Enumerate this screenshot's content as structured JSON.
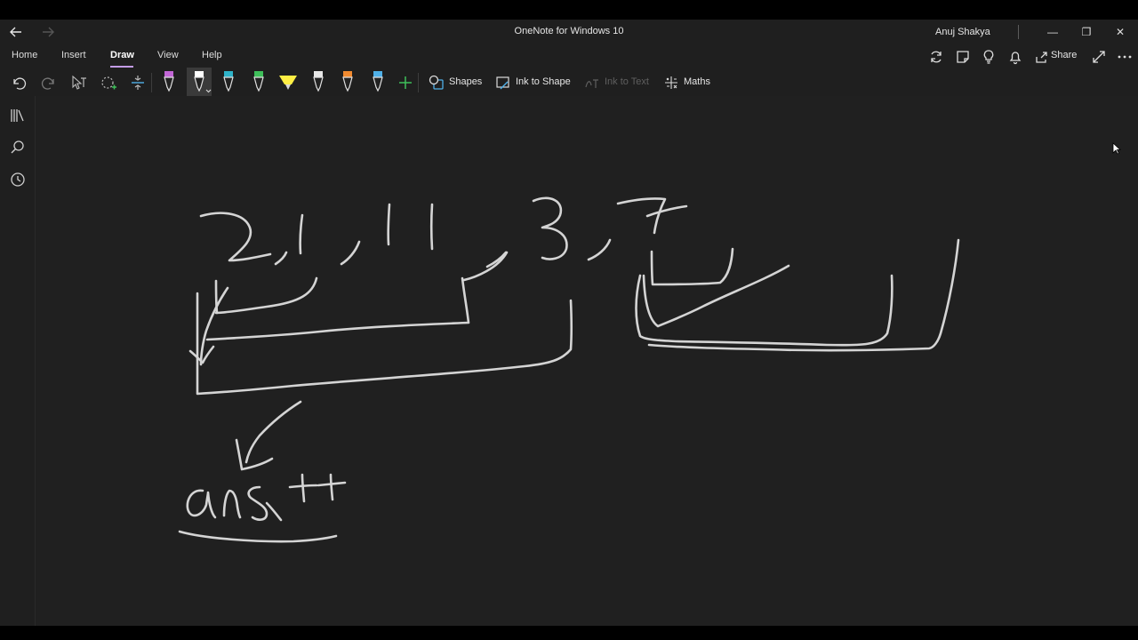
{
  "window": {
    "title": "OneNote for Windows 10",
    "user": "Anuj Shakya",
    "back_icon": "arrow-left-icon",
    "forward_icon": "arrow-right-icon",
    "minimize_glyph": "—",
    "maximize_glyph": "❐",
    "close_glyph": "✕"
  },
  "tabs": [
    {
      "label": "Home"
    },
    {
      "label": "Insert"
    },
    {
      "label": "Draw",
      "active": true
    },
    {
      "label": "View"
    },
    {
      "label": "Help"
    }
  ],
  "header_tools": {
    "icons": [
      "sync-icon",
      "sticky-note-icon",
      "lightbulb-icon",
      "bell-icon"
    ],
    "share_label": "Share"
  },
  "draw_toolbar": {
    "undo_icon": "undo-icon",
    "redo_icon": "redo-icon",
    "shapes_label": "Shapes",
    "ink_to_shape_label": "Ink to Shape",
    "ink_to_text_label": "Ink to Text",
    "maths_label": "Maths",
    "pens": [
      {
        "kind": "pen",
        "color": "#c266d6"
      },
      {
        "kind": "pen",
        "color": "#ffffff",
        "selected": true
      },
      {
        "kind": "pen",
        "color": "#2fb3c9"
      },
      {
        "kind": "pen",
        "color": "#3fbf5a"
      },
      {
        "kind": "highlighter",
        "color": "#ffee44"
      },
      {
        "kind": "pen",
        "color": "#e8e8e8"
      },
      {
        "kind": "pen",
        "color": "#f08a30"
      },
      {
        "kind": "pen",
        "color": "#4fb0e8"
      }
    ]
  },
  "sidebar": {
    "icons": [
      "notebooks-icon",
      "search-icon",
      "recent-icon"
    ]
  },
  "colors": {
    "background": "#1f1f1f",
    "canvas": "#202020",
    "ink": "#d4d4d4",
    "accent": "#c39ce6"
  }
}
